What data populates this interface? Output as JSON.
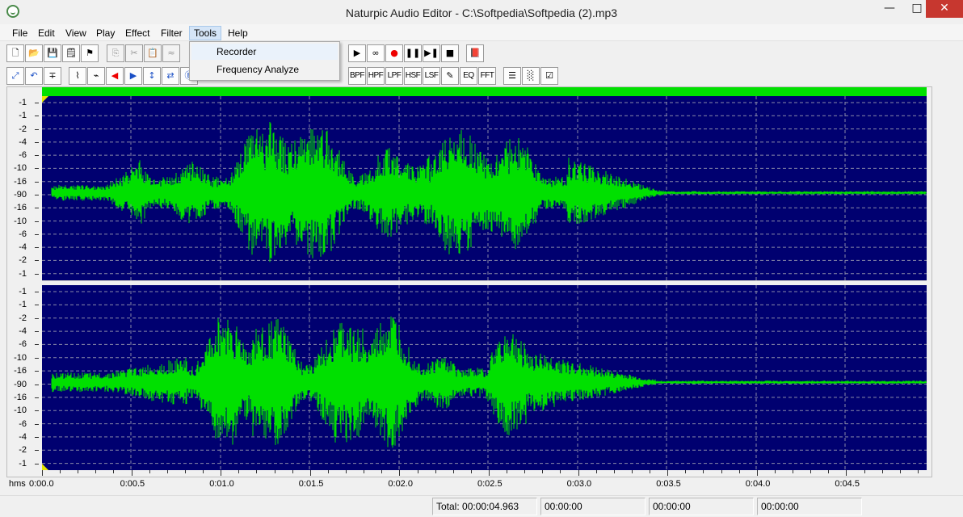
{
  "window": {
    "title": "Naturpic Audio Editor - C:\\Softpedia\\Softpedia (2).mp3",
    "minimize_glyph": "—",
    "maximize_glyph": "□",
    "close_glyph": "✕"
  },
  "menu": {
    "items": [
      "File",
      "Edit",
      "View",
      "Play",
      "Effect",
      "Filter",
      "Tools",
      "Help"
    ],
    "open_menu": "Tools",
    "tools_dropdown": [
      "Recorder",
      "Frequency Analyze"
    ]
  },
  "toolbar1": {
    "buttons": [
      {
        "name": "new-file",
        "glyph": "🗋"
      },
      {
        "name": "open-file",
        "glyph": "📂"
      },
      {
        "name": "save-file",
        "glyph": "💾"
      },
      {
        "name": "file-properties",
        "glyph": "🗒"
      },
      {
        "name": "undo-history",
        "glyph": "⚑"
      },
      {
        "name": "copy",
        "glyph": "⎘"
      },
      {
        "name": "cut",
        "glyph": "✂"
      },
      {
        "name": "paste",
        "glyph": "📋"
      },
      {
        "name": "mix-paste",
        "glyph": "≈"
      },
      {
        "name": "play",
        "glyph": "▶"
      },
      {
        "name": "loop",
        "glyph": "∞"
      },
      {
        "name": "record",
        "glyph": "●"
      },
      {
        "name": "pause",
        "glyph": "❚❚"
      },
      {
        "name": "play-selection",
        "glyph": "▶❚"
      },
      {
        "name": "stop",
        "glyph": "■"
      },
      {
        "name": "help-book",
        "glyph": "📕"
      }
    ]
  },
  "toolbar2": {
    "buttons": [
      {
        "name": "zoom-fit",
        "glyph": "⤢"
      },
      {
        "name": "undo",
        "glyph": "↶"
      },
      {
        "name": "insert-silence",
        "glyph": "∓"
      },
      {
        "name": "normalize",
        "glyph": "⌇"
      },
      {
        "name": "amplify",
        "glyph": "⌁"
      },
      {
        "name": "fade-in",
        "glyph": "◀"
      },
      {
        "name": "fade-out",
        "glyph": "▶"
      },
      {
        "name": "vertical-flip",
        "glyph": "↕"
      },
      {
        "name": "reverse",
        "glyph": "⇄"
      },
      {
        "name": "echo",
        "glyph": "Ⓔ"
      },
      {
        "name": "bpf",
        "glyph": "BPF"
      },
      {
        "name": "hpf",
        "glyph": "HPF"
      },
      {
        "name": "lpf",
        "glyph": "LPF"
      },
      {
        "name": "hsf",
        "glyph": "HSF"
      },
      {
        "name": "lsf",
        "glyph": "LSF"
      },
      {
        "name": "notch",
        "glyph": "✎"
      },
      {
        "name": "eq",
        "glyph": "EQ"
      },
      {
        "name": "fft",
        "glyph": "FFT"
      },
      {
        "name": "sample-rate",
        "glyph": "☰"
      },
      {
        "name": "noise-reduction",
        "glyph": "░"
      },
      {
        "name": "channel-convert",
        "glyph": "☑"
      }
    ]
  },
  "waveform": {
    "y_labels": [
      "-1",
      "-1",
      "-2",
      "-4",
      "-6",
      "-10",
      "-16",
      "-90",
      "-16",
      "-10",
      "-6",
      "-4",
      "-2",
      "-1"
    ],
    "colors": {
      "background": "#000070",
      "wave": "#00e000",
      "grid": "#8a8aa8"
    }
  },
  "timeline": {
    "unit": "hms",
    "labels": [
      "0:00.0",
      "0:00.5",
      "0:01.0",
      "0:01.5",
      "0:02.0",
      "0:02.5",
      "0:03.0",
      "0:03.5",
      "0:04.0",
      "0:04.5"
    ]
  },
  "status": {
    "total": "Total: 00:00:04.963",
    "cell2": "00:00:00",
    "cell3": "00:00:00",
    "cell4": "00:00:00"
  }
}
